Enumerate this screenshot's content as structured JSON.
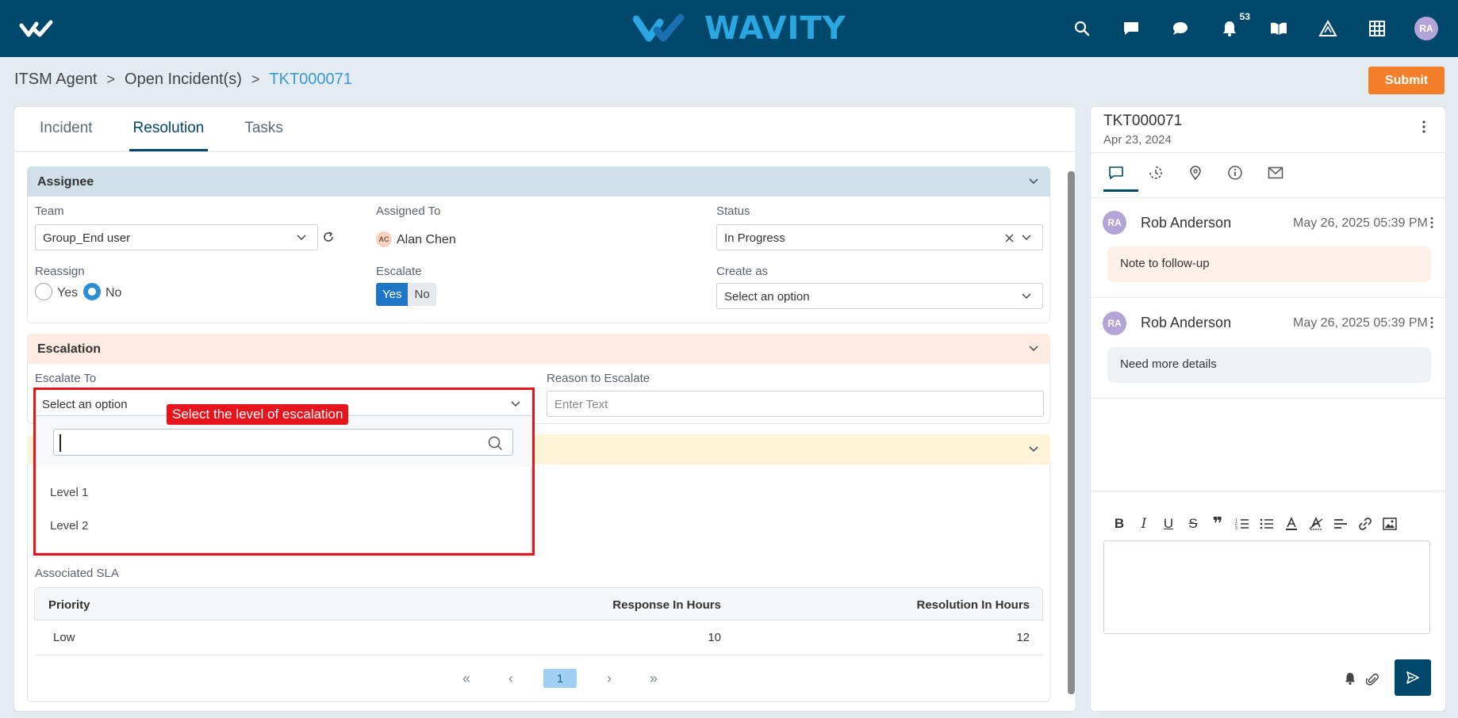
{
  "app": {
    "brand": "WAVITY",
    "notification_count": "53",
    "user_initials": "RA"
  },
  "breadcrumb": {
    "items": [
      "ITSM Agent",
      "Open Incident(s)"
    ],
    "current": "TKT000071",
    "sep": ">"
  },
  "actions": {
    "submit_label": "Submit"
  },
  "tabs": [
    {
      "label": "Incident",
      "active": false
    },
    {
      "label": "Resolution",
      "active": true
    },
    {
      "label": "Tasks",
      "active": false
    }
  ],
  "assignee": {
    "title": "Assignee",
    "team_label": "Team",
    "team_value": "Group_End user",
    "assigned_to_label": "Assigned To",
    "assigned_to_initials": "AC",
    "assigned_to_value": "Alan Chen",
    "status_label": "Status",
    "status_value": "In Progress",
    "reassign_label": "Reassign",
    "reassign_yes": "Yes",
    "reassign_no": "No",
    "escalate_label": "Escalate",
    "escalate_yes": "Yes",
    "escalate_no": "No",
    "create_as_label": "Create as",
    "create_as_value": "Select an option"
  },
  "escalation": {
    "title": "Escalation",
    "escalate_to_label": "Escalate To",
    "escalate_to_value": "Select an option",
    "reason_label": "Reason to Escalate",
    "reason_placeholder": "Enter Text",
    "options": [
      "Level 1",
      "Level 2"
    ],
    "annotation": "Select the level of escalation"
  },
  "colors": {
    "topbar": "#00486b",
    "accent": "#2aa7e0",
    "submit": "#f47f2a",
    "assignee_header": "#cfe0e8",
    "escalation_header": "#fdebe2",
    "third_header": "#fdf3d6",
    "annotation_red": "#e8141c"
  },
  "sla": {
    "title": "Associated SLA",
    "columns": [
      "Priority",
      "Response In Hours",
      "Resolution In Hours"
    ],
    "rows": [
      [
        "Low",
        "10",
        "12"
      ]
    ]
  },
  "pager": {
    "first": "«",
    "prev": "‹",
    "page": "1",
    "next": "›",
    "last": "»"
  },
  "right_panel": {
    "ticket": "TKT000071",
    "date": "Apr 23, 2024",
    "comments": [
      {
        "initials": "RA",
        "name": "Rob Anderson",
        "time": "May 26, 2025 05:39 PM",
        "text": "Note to follow-up",
        "bubble": "#fdf1ea"
      },
      {
        "initials": "RA",
        "name": "Rob Anderson",
        "time": "May 26, 2025 05:39 PM",
        "text": "Need more details",
        "bubble": "#eff2f5"
      }
    ],
    "toolbar": [
      "bold-icon",
      "italic-icon",
      "underline-icon",
      "strikethrough-icon",
      "quote-icon",
      "ordered-list-icon",
      "bullet-list-icon",
      "font-color-icon",
      "clear-format-icon",
      "align-icon",
      "link-icon",
      "image-icon"
    ]
  }
}
